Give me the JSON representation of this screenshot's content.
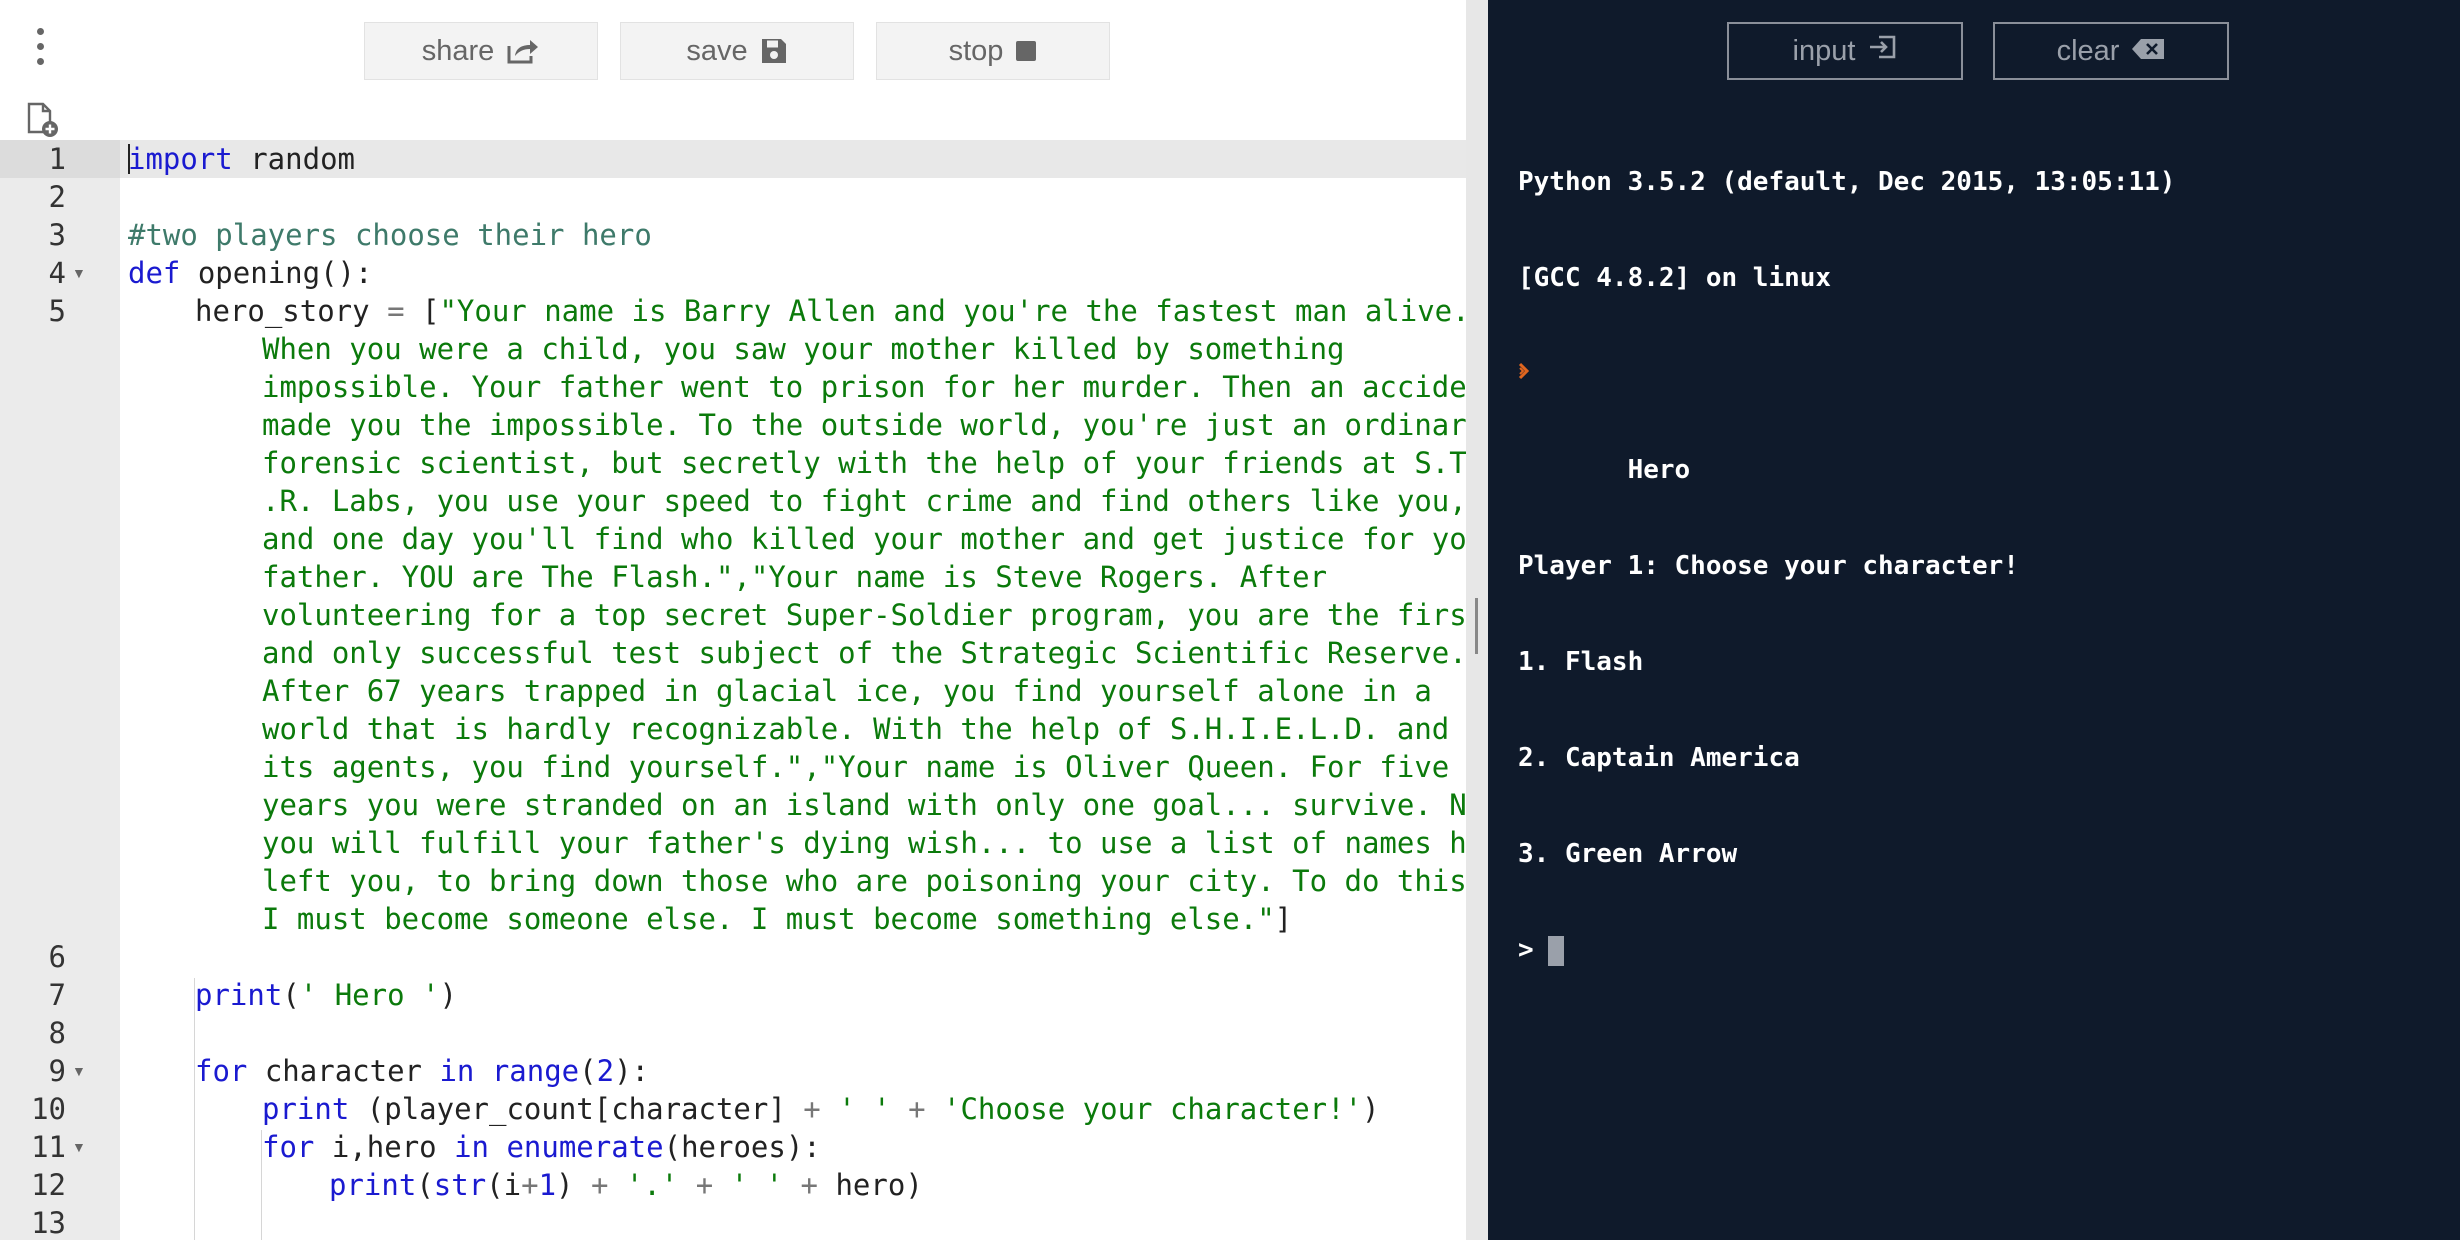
{
  "toolbar": {
    "share_label": "share",
    "save_label": "save",
    "stop_label": "stop"
  },
  "console_toolbar": {
    "input_label": "input",
    "clear_label": "clear"
  },
  "editor": {
    "line_numbers": [
      "1",
      "2",
      "3",
      "4",
      "5",
      "6",
      "7",
      "8",
      "9",
      "10",
      "11",
      "12",
      "13"
    ],
    "lines": {
      "l1_kw": "import",
      "l1_rest": " random",
      "l3": "#two players choose their hero",
      "l4_kw": "def",
      "l4_rest": " opening():",
      "l5_var": "hero_story",
      "l5_eq": " = ",
      "l5_br": "[",
      "story": [
        "\"Your name is Barry Allen and you're the fastest man alive.",
        "When you were a child, you saw your mother killed by something",
        "impossible. Your father went to prison for her murder. Then an accident",
        "made you the impossible. To the outside world, you're just an ordinary",
        "forensic scientist, but secretly with the help of your friends at S.T.A",
        ".R. Labs, you use your speed to fight crime and find others like you,",
        "and one day you'll find who killed your mother and get justice for you",
        "father. YOU are The Flash.\",\"Your name is Steve Rogers. After",
        "volunteering for a top secret Super-Soldier program, you are the first",
        "and only successful test subject of the Strategic Scientific Reserve.",
        "After 67 years trapped in glacial ice, you find yourself alone in a",
        "world that is hardly recognizable. With the help of S.H.I.E.L.D. and",
        "its agents, you find yourself.\",\"Your name is Oliver Queen. For five",
        "years you were stranded on an island with only one goal... survive. Now",
        "you will fulfill your father's dying wish... to use a list of names he",
        "left you, to bring down those who are poisoning your city. To do this,",
        "I must become someone else. I must become something else.\""
      ],
      "story_close": "]",
      "l7_fn": "print",
      "l7_open": "(",
      "l7_str": "' Hero '",
      "l7_close": ")",
      "l9_for": "for",
      "l9_var": " character ",
      "l9_in": "in",
      "l9_sp": " ",
      "l9_range": "range",
      "l9_open": "(",
      "l9_num": "2",
      "l9_close": "):",
      "l10_print": "print",
      "l10_a": " (player_count[character] ",
      "l10_plus1": "+",
      "l10_sp1": " ",
      "l10_s1": "' '",
      "l10_sp2": " ",
      "l10_plus2": "+",
      "l10_sp3": " ",
      "l10_s2": "'Choose your character!'",
      "l10_close": ")",
      "l11_for": "for",
      "l11_a": " i,hero ",
      "l11_in": "in",
      "l11_sp": " ",
      "l11_enum": "enumerate",
      "l11_b": "(heroes):",
      "l12_print": "print",
      "l12_open": "(",
      "l12_str": "str",
      "l12_a": "(i",
      "l12_plus1": "+",
      "l12_num": "1",
      "l12_b": ") ",
      "l12_plus2": "+",
      "l12_sp1": " ",
      "l12_s1": "'.'",
      "l12_sp2": " ",
      "l12_plus3": "+",
      "l12_sp3": " ",
      "l12_s2": "' '",
      "l12_sp4": " ",
      "l12_plus4": "+",
      "l12_c": " hero)"
    }
  },
  "console": {
    "lines": [
      "Python 3.5.2 (default, Dec 2015, 13:05:11)",
      "[GCC 4.8.2] on linux",
      "",
      "       Hero",
      "Player 1: Choose your character!",
      "1. Flash",
      "2. Captain America",
      "3. Green Arrow"
    ],
    "prompt": ">"
  },
  "colors": {
    "console_bg": "#0f1a2b",
    "keyword": "#1a1ad0",
    "string": "#0b7a0b",
    "comment": "#3e7a6a",
    "prompt_chevron": "#e0661f"
  },
  "icons": {
    "menu": "vertical-dots-icon",
    "new_file": "new-file-icon",
    "share": "share-icon",
    "save": "floppy-disk-icon",
    "stop": "stop-square-icon",
    "input": "input-enter-icon",
    "clear": "backspace-icon"
  }
}
